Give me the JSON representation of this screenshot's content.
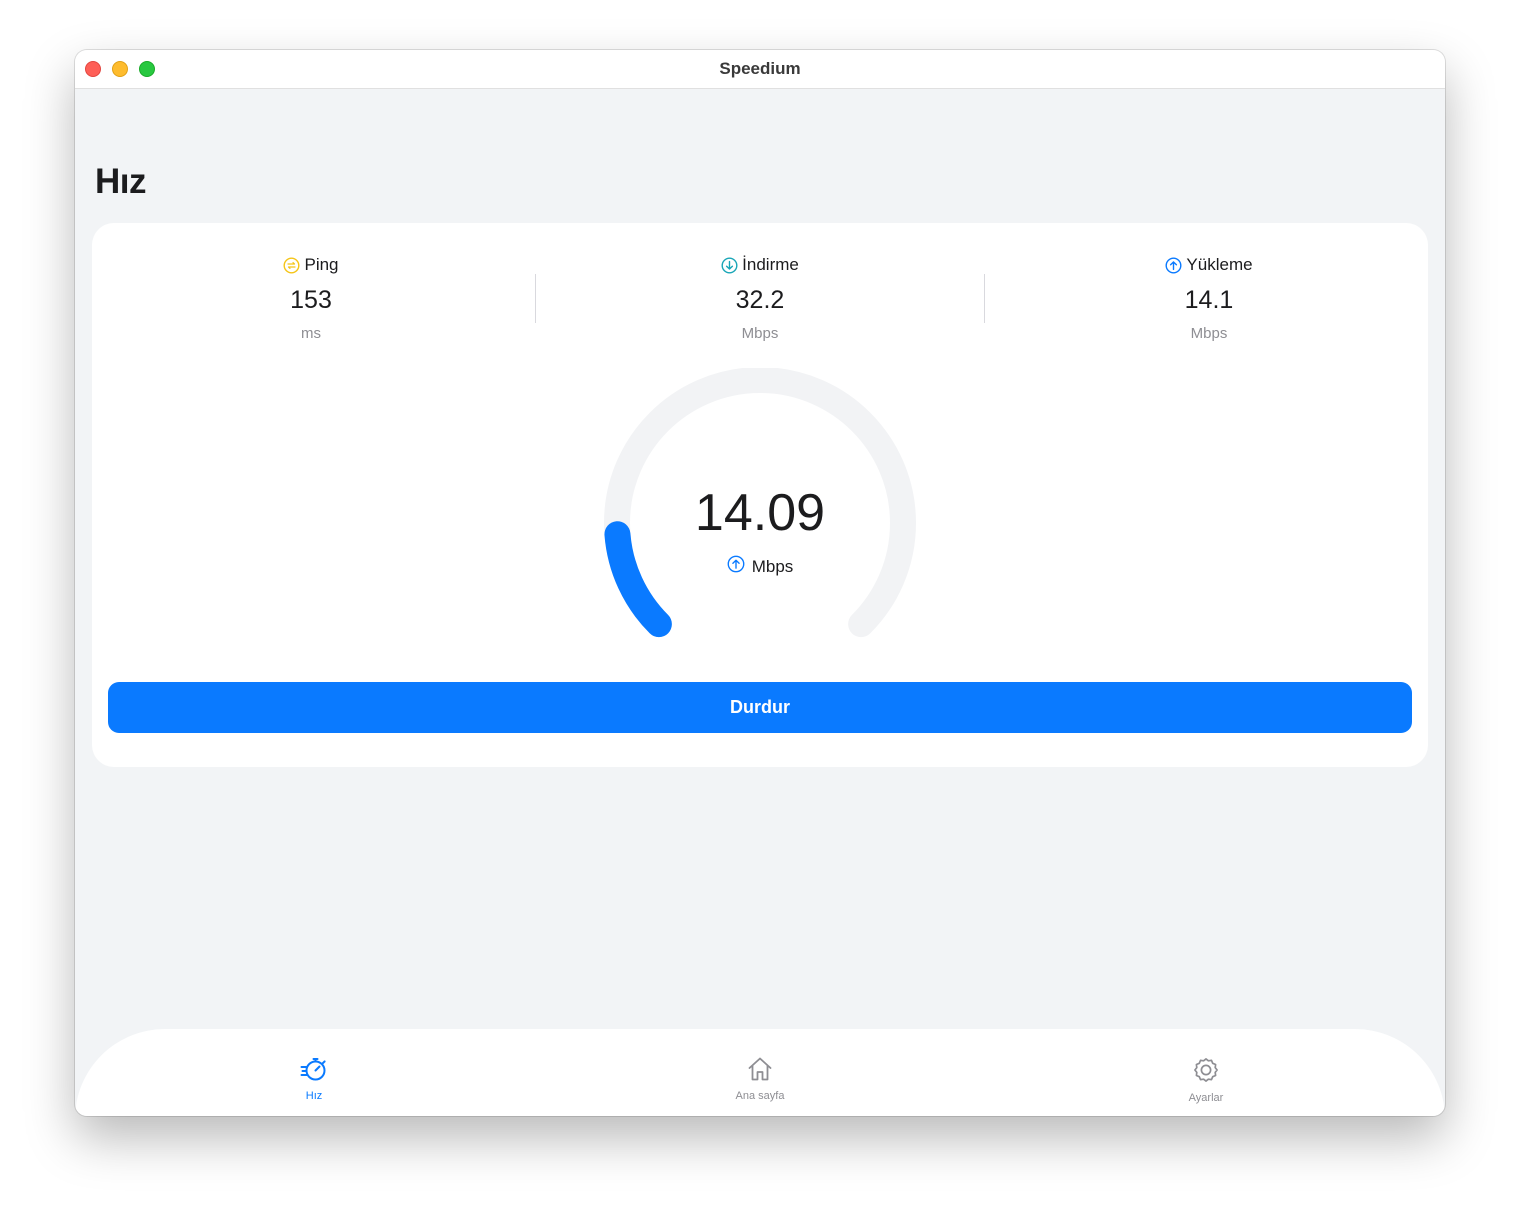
{
  "window": {
    "title": "Speedium"
  },
  "page": {
    "title": "Hız"
  },
  "stats": {
    "ping": {
      "label": "Ping",
      "value": "153",
      "unit": "ms",
      "icon": "ping-icon",
      "color": "#f5c518"
    },
    "download": {
      "label": "İndirme",
      "value": "32.2",
      "unit": "Mbps",
      "icon": "download-arrow-icon",
      "color": "#1aa6b7"
    },
    "upload": {
      "label": "Yükleme",
      "value": "14.1",
      "unit": "Mbps",
      "icon": "upload-arrow-icon",
      "color": "#0a7aff"
    }
  },
  "gauge": {
    "value": "14.09",
    "unit": "Mbps",
    "progress_fraction": 0.15,
    "track_color": "#f2f3f5",
    "fill_color": "#0a7aff",
    "icon": "upload-arrow-icon"
  },
  "actions": {
    "stop_label": "Durdur"
  },
  "tabbar": {
    "tabs": [
      {
        "label": "Hız",
        "icon": "speedometer-icon",
        "active": true
      },
      {
        "label": "Ana sayfa",
        "icon": "home-icon",
        "active": false
      },
      {
        "label": "Ayarlar",
        "icon": "gear-icon",
        "active": false
      }
    ]
  },
  "colors": {
    "accent": "#0a7aff",
    "background": "#f2f4f6",
    "card": "#ffffff",
    "inactive": "#8e8e93"
  }
}
